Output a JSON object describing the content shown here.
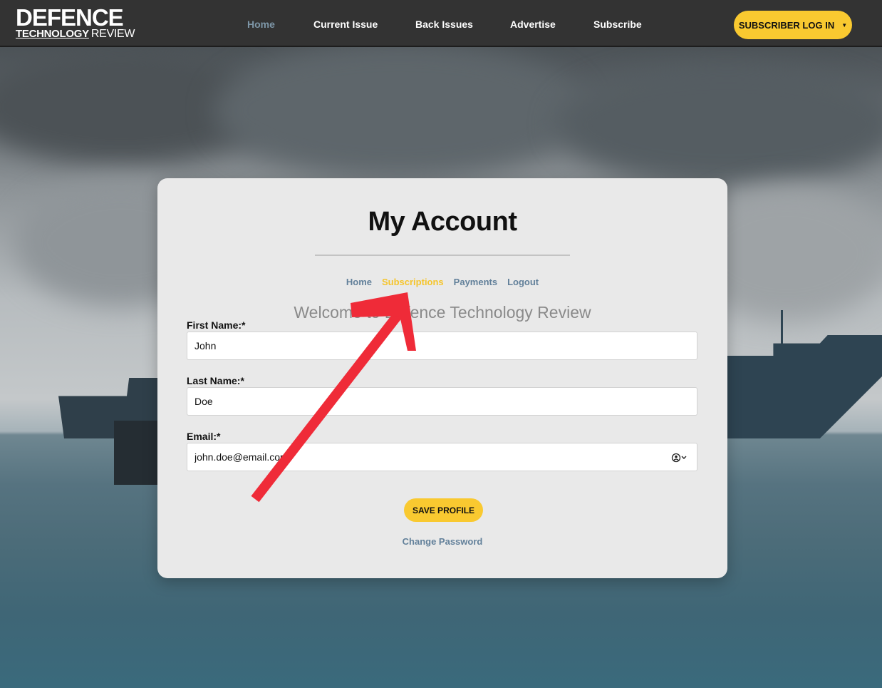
{
  "header": {
    "logo": {
      "line1": "DEFENCE",
      "line2_bold": "TECHNOLOGY",
      "line2_light": "REVIEW"
    },
    "nav": [
      {
        "label": "Home",
        "active": true
      },
      {
        "label": "Current Issue",
        "active": false
      },
      {
        "label": "Back Issues",
        "active": false
      },
      {
        "label": "Advertise",
        "active": false
      },
      {
        "label": "Subscribe",
        "active": false
      }
    ],
    "login_button": "SUBSCRIBER LOG IN",
    "login_caret": "▼"
  },
  "account": {
    "title": "My Account",
    "subnav": [
      {
        "label": "Home",
        "current": false
      },
      {
        "label": "Subscriptions",
        "current": true
      },
      {
        "label": "Payments",
        "current": false
      },
      {
        "label": "Logout",
        "current": false
      }
    ],
    "welcome": "Welcome to Defence Technology Review",
    "fields": {
      "first_name": {
        "label": "First Name:*",
        "value": "John"
      },
      "last_name": {
        "label": "Last Name:*",
        "value": "Doe"
      },
      "email": {
        "label": "Email:*",
        "value": "john.doe@email.com",
        "icon": "contact-card-icon"
      }
    },
    "save_button": "SAVE PROFILE",
    "change_password": "Change Password"
  },
  "colors": {
    "header_bg": "#333333",
    "accent_yellow": "#f9c930",
    "link_blue": "#62809a",
    "nav_active": "#7e97a8",
    "annotation_red": "#ef2b38"
  }
}
